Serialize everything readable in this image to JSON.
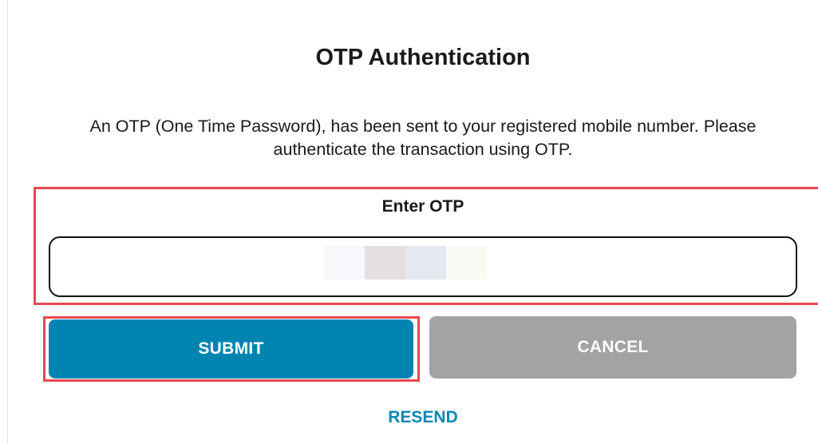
{
  "header": {
    "title": "OTP Authentication"
  },
  "message": {
    "text": "An OTP (One Time Password), has been sent to your registered mobile number. Please authenticate the transaction using OTP."
  },
  "otp": {
    "label": "Enter OTP",
    "value": "",
    "placeholder": ""
  },
  "actions": {
    "submit_label": "SUBMIT",
    "cancel_label": "CANCEL",
    "resend_label": "RESEND"
  },
  "colors": {
    "primary": "#0085b2",
    "secondary": "#a3a3a3",
    "link": "#0c87b5",
    "highlight": "#e8474f"
  }
}
